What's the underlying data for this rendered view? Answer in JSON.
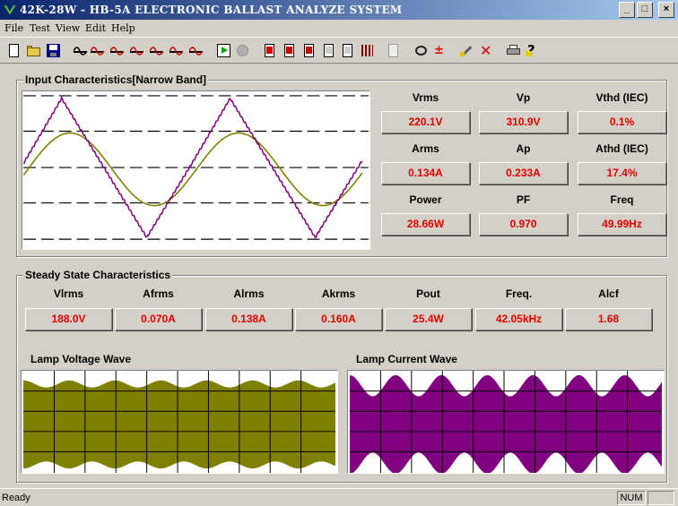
{
  "window": {
    "title": "42K-28W - HB-5A  ELECTRONIC BALLAST  ANALYZE SYSTEM",
    "minimize": "_",
    "maximize": "□",
    "close": "×"
  },
  "menu": [
    "File",
    "Test",
    "View",
    "Edit",
    "Help"
  ],
  "toolbar_icons": [
    "new-file-icon",
    "open-folder-icon",
    "save-disk-icon",
    "test-1-icon",
    "test-2-icon",
    "test-3-icon",
    "test-4-icon",
    "test-5-icon",
    "test-6-icon",
    "test-7-icon",
    "run-icon",
    "stop-icon",
    "report-1-icon",
    "report-2-icon",
    "report-3-icon",
    "report-4-icon",
    "report-5-icon",
    "grid-icon",
    "page-icon",
    "settings-icon",
    "plus-minus-icon",
    "wrench-icon",
    "delete-icon",
    "print-icon",
    "help-icon"
  ],
  "input_group": {
    "title": "Input Characteristics[Narrow Band]",
    "params": [
      {
        "label": "Vrms",
        "value": "220.1V"
      },
      {
        "label": "Vp",
        "value": "310.9V"
      },
      {
        "label": "Vthd  (IEC)",
        "value": "0.1%"
      },
      {
        "label": "Arms",
        "value": "0.134A"
      },
      {
        "label": "Ap",
        "value": "0.233A"
      },
      {
        "label": "Athd  (IEC)",
        "value": "17.4%"
      },
      {
        "label": "Power",
        "value": "28.66W"
      },
      {
        "label": "PF",
        "value": "0.970"
      },
      {
        "label": "Freq",
        "value": "49.99Hz"
      }
    ]
  },
  "steady_group": {
    "title": "Steady State Characteristics",
    "params": [
      {
        "label": "Vlrms",
        "value": "188.0V"
      },
      {
        "label": "Afrms",
        "value": "0.070A"
      },
      {
        "label": "Alrms",
        "value": "0.138A"
      },
      {
        "label": "Akrms",
        "value": "0.160A"
      },
      {
        "label": "Pout",
        "value": "25.4W"
      },
      {
        "label": "Freq.",
        "value": "42.05kHz"
      },
      {
        "label": "Alcf",
        "value": "1.68"
      }
    ]
  },
  "lamp_voltage": {
    "title": "Lamp Voltage Wave",
    "color": "#808000"
  },
  "lamp_current": {
    "title": "Lamp Current Wave",
    "color": "#800080"
  },
  "input_wave": {
    "voltage_color": "#808000",
    "current_color": "#800080"
  },
  "status": {
    "text": "Ready",
    "num": "NUM"
  }
}
